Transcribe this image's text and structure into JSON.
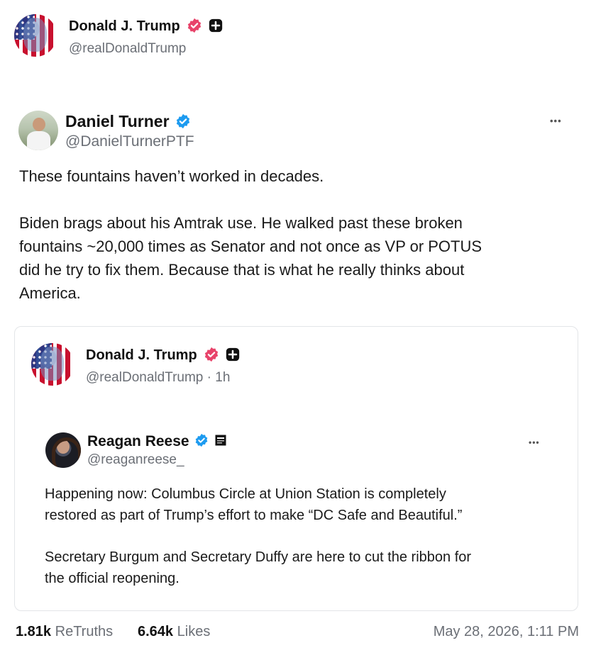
{
  "header": {
    "name": "Donald J. Trump",
    "handle": "@realDonaldTrump"
  },
  "post": {
    "name": "Daniel Turner",
    "handle": "@DanielTurnerPTF",
    "more": "•••",
    "paragraph1": "These fountains haven’t worked in  decades.",
    "paragraph2_lines": [
      "Biden brags about his Amtrak use. He walked past these broken",
      "fountains ~20,000 times as Senator and not once as VP or POTUS",
      "did he try to fix them. Because that is what he really thinks about",
      "America."
    ]
  },
  "quote": {
    "name": "Donald J. Trump",
    "handle": "@realDonaldTrump · 1h",
    "inner": {
      "name": "Reagan Reese",
      "handle": "@reaganreese_",
      "more": "•••",
      "paragraph1_lines": [
        "Happening now: Columbus Circle at Union Station is completely",
        "restored as part of Trump’s effort to make “DC Safe and Beautiful.”"
      ],
      "paragraph2_lines": [
        "Secretary Burgum and Secretary Duffy are here to cut the ribbon for",
        "the official reopening."
      ]
    }
  },
  "footer": {
    "retruths_count": "1.81k",
    "retruths_label": "ReTruths",
    "likes_count": "6.64k",
    "likes_label": "Likes",
    "timestamp": "May 28, 2026, 1:11 PM"
  },
  "colors": {
    "verified_truth": "#e8436a",
    "verified_x": "#1d9bf0",
    "text_muted": "#6b6f76"
  }
}
